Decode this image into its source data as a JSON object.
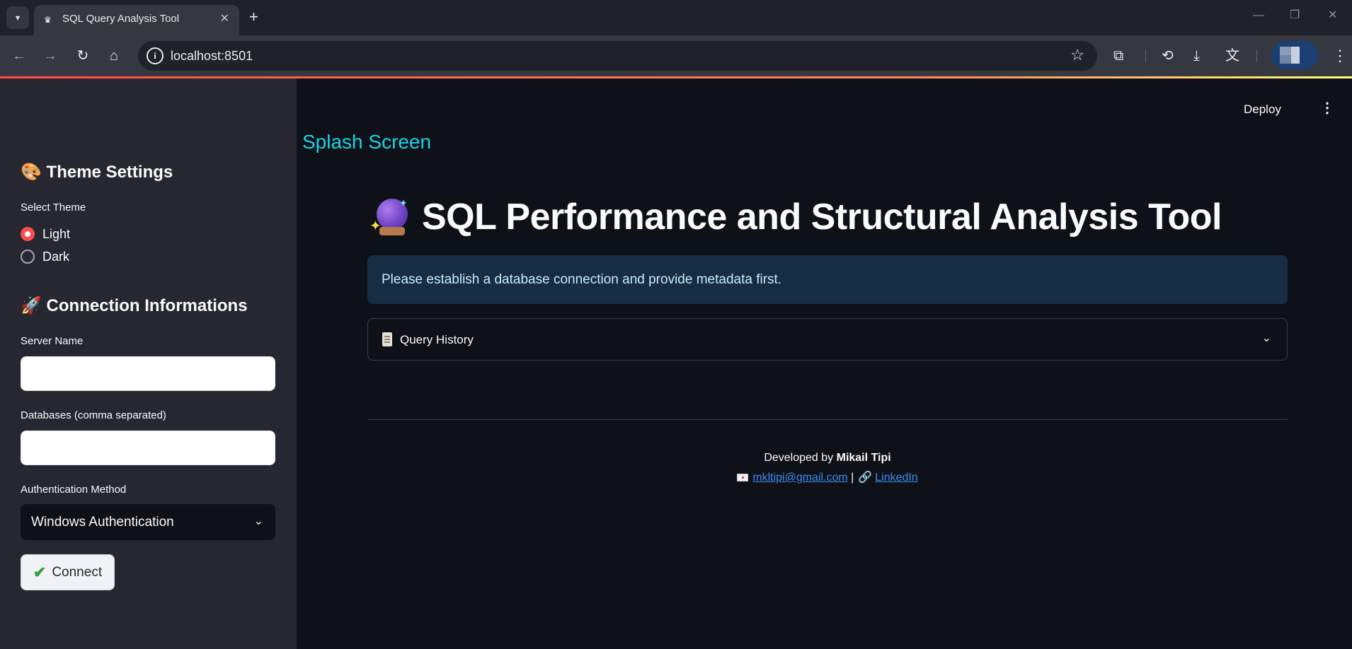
{
  "browser": {
    "tab_title": "SQL Query Analysis Tool",
    "url": "localhost:8501",
    "icons": {
      "tab_menu": "chevron-down-icon",
      "tab_favicon": "streamlit-crown-icon",
      "tab_close": "close-icon",
      "new_tab": "plus-icon",
      "back": "arrow-left-icon",
      "forward": "arrow-right-icon",
      "reload": "reload-icon",
      "home": "home-icon",
      "site_info": "info-icon",
      "bookmark": "star-icon",
      "extensions": "puzzle-icon",
      "history": "history-icon",
      "downloads": "download-icon",
      "translate": "translate-icon",
      "menu": "kebab-icon"
    }
  },
  "sidebar": {
    "theme_heading": "🎨 Theme Settings",
    "theme_label": "Select Theme",
    "theme_options": [
      "Light",
      "Dark"
    ],
    "theme_selected": "Light",
    "connection_heading": "🚀 Connection Informations",
    "server_label": "Server Name",
    "server_value": "",
    "databases_label": "Databases (comma separated)",
    "databases_value": "",
    "auth_label": "Authentication Method",
    "auth_selected": "Windows Authentication",
    "connect_label": "Connect"
  },
  "main": {
    "deploy_label": "Deploy",
    "splash_link": "Splash Screen",
    "title": "SQL Performance and Structural Analysis Tool",
    "info_message": "Please establish a database connection and provide metadata first.",
    "expander_label": "Query History",
    "footer": {
      "developed_by": "Developed by",
      "author": "Mikail Tipi",
      "email": "mkltipi@gmail.com",
      "separator": "|",
      "linkedin": "LinkedIn"
    }
  },
  "colors": {
    "accent": "#ff4b4b",
    "link": "#3d8df5",
    "splash": "#19d3e6",
    "info_bg": "#172d43",
    "sidebar_bg": "#262730",
    "main_bg": "#0e1117"
  }
}
